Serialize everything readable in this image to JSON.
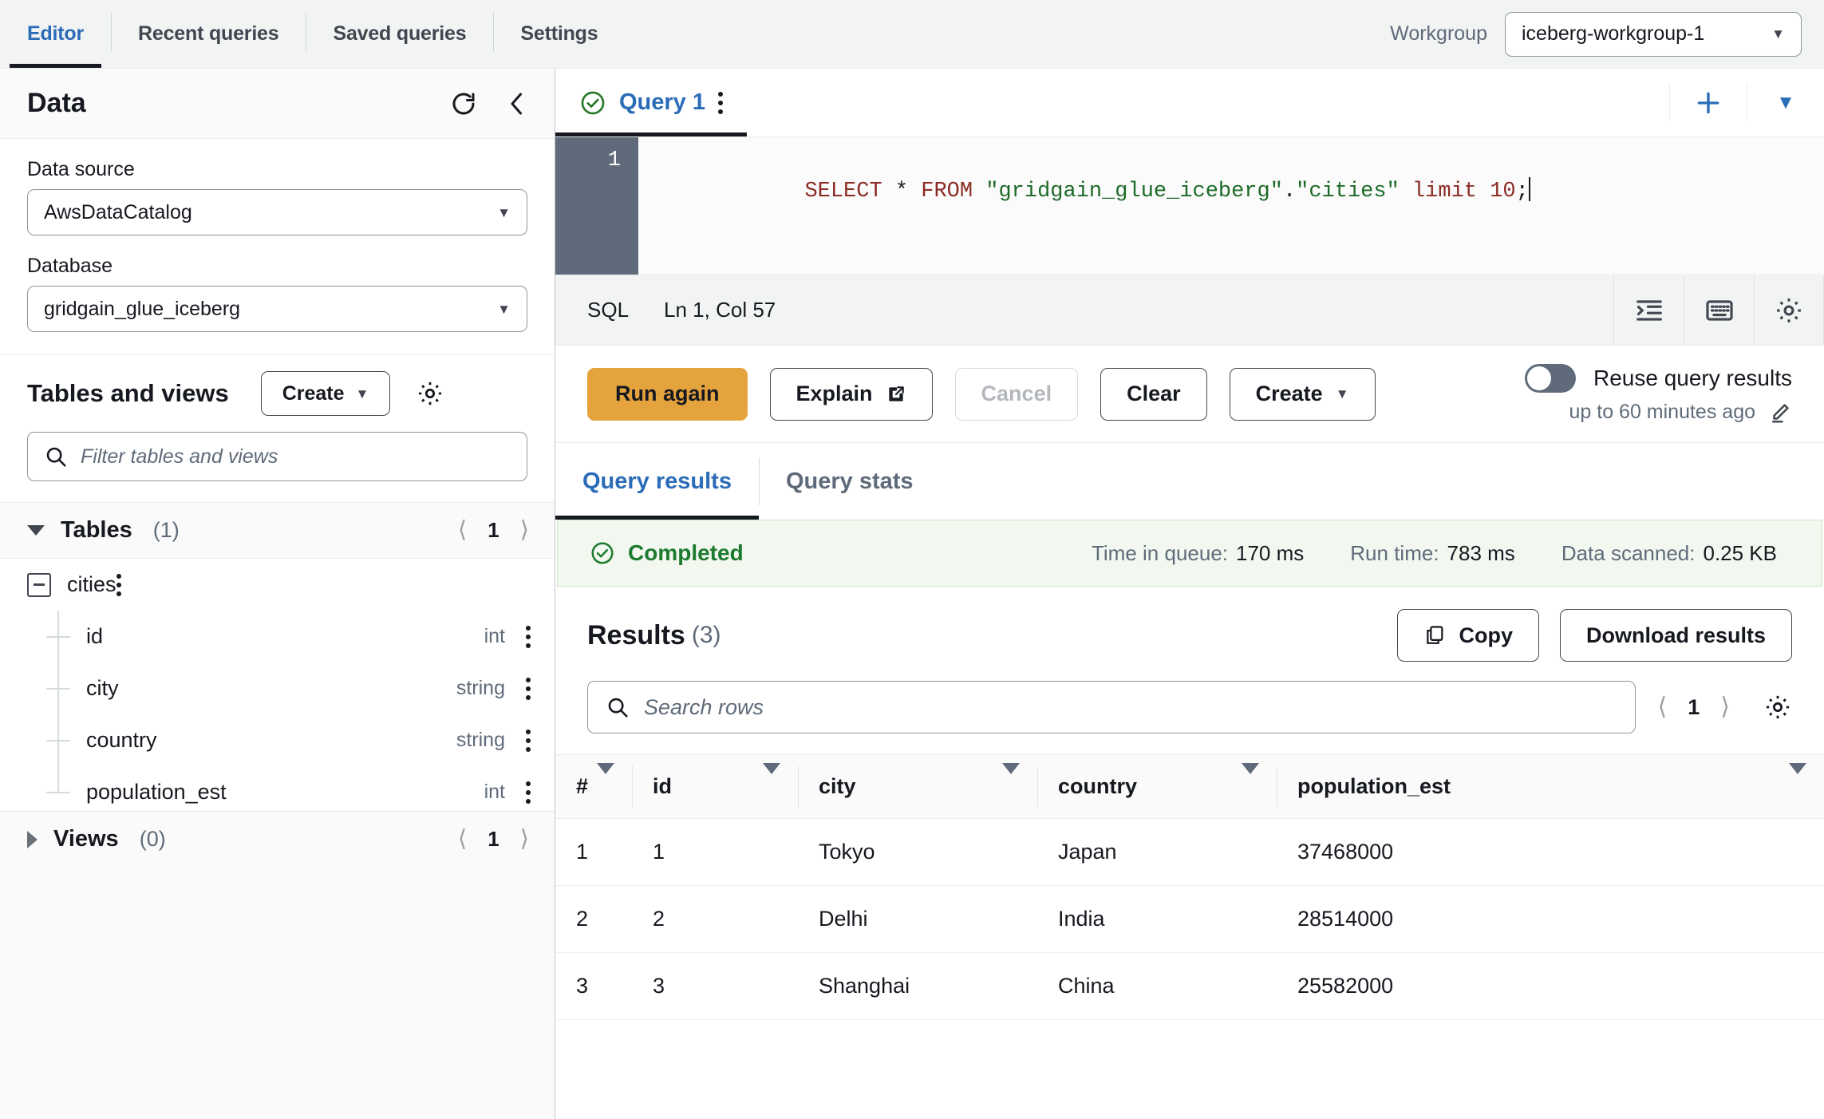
{
  "topnav": {
    "tabs": [
      {
        "label": "Editor",
        "active": true
      },
      {
        "label": "Recent queries",
        "active": false
      },
      {
        "label": "Saved queries",
        "active": false
      },
      {
        "label": "Settings",
        "active": false
      }
    ],
    "workgroup_label": "Workgroup",
    "workgroup_value": "iceberg-workgroup-1"
  },
  "sidebar": {
    "title": "Data",
    "data_source_label": "Data source",
    "data_source_value": "AwsDataCatalog",
    "database_label": "Database",
    "database_value": "gridgain_glue_iceberg",
    "tables_views_title": "Tables and views",
    "create_label": "Create",
    "filter_placeholder": "Filter tables and views",
    "tables_group": {
      "name": "Tables",
      "count": "(1)",
      "page": "1"
    },
    "views_group": {
      "name": "Views",
      "count": "(0)",
      "page": "1"
    },
    "table_name": "cities",
    "columns": [
      {
        "name": "id",
        "type": "int"
      },
      {
        "name": "city",
        "type": "string"
      },
      {
        "name": "country",
        "type": "string"
      },
      {
        "name": "population_est",
        "type": "int"
      }
    ]
  },
  "editor": {
    "tab_label": "Query 1",
    "line_number": "1",
    "sql_tokens": [
      {
        "t": "SELECT",
        "c": "kw"
      },
      {
        "t": " ",
        "c": "plain"
      },
      {
        "t": "*",
        "c": "punct"
      },
      {
        "t": " ",
        "c": "plain"
      },
      {
        "t": "FROM",
        "c": "kw"
      },
      {
        "t": " ",
        "c": "plain"
      },
      {
        "t": "\"gridgain_glue_iceberg\"",
        "c": "str"
      },
      {
        "t": ".",
        "c": "punct"
      },
      {
        "t": "\"cities\"",
        "c": "str"
      },
      {
        "t": " ",
        "c": "plain"
      },
      {
        "t": "limit",
        "c": "kw"
      },
      {
        "t": " ",
        "c": "plain"
      },
      {
        "t": "10",
        "c": "kw"
      },
      {
        "t": ";",
        "c": "punct"
      }
    ],
    "sql_text": "SELECT * FROM \"gridgain_glue_iceberg\".\"cities\" limit 10;",
    "language": "SQL",
    "cursor_position": "Ln 1, Col 57"
  },
  "actions": {
    "run_again": "Run again",
    "explain": "Explain",
    "cancel": "Cancel",
    "clear": "Clear",
    "create": "Create",
    "reuse_label": "Reuse query results",
    "reuse_sub": "up to 60 minutes ago",
    "reuse_enabled": false
  },
  "result_tabs": [
    {
      "label": "Query results",
      "active": true
    },
    {
      "label": "Query stats",
      "active": false
    }
  ],
  "status": {
    "state": "Completed",
    "time_in_queue_label": "Time in queue:",
    "time_in_queue_value": "170 ms",
    "run_time_label": "Run time:",
    "run_time_value": "783 ms",
    "data_scanned_label": "Data scanned:",
    "data_scanned_value": "0.25 KB"
  },
  "results": {
    "title": "Results",
    "count": "(3)",
    "copy_label": "Copy",
    "download_label": "Download results",
    "search_placeholder": "Search rows",
    "page": "1",
    "columns": [
      "#",
      "id",
      "city",
      "country",
      "population_est"
    ],
    "rows": [
      {
        "num": "1",
        "id": "1",
        "city": "Tokyo",
        "country": "Japan",
        "population_est": "37468000"
      },
      {
        "num": "2",
        "id": "2",
        "city": "Delhi",
        "country": "India",
        "population_est": "28514000"
      },
      {
        "num": "3",
        "id": "3",
        "city": "Shanghai",
        "country": "China",
        "population_est": "25582000"
      }
    ]
  },
  "colors": {
    "accent_blue": "#2b6cb8",
    "primary_orange": "#e5a33d",
    "success_green": "#1d7b2f",
    "sql_keyword": "#8b2c24",
    "sql_string": "#1d6b28"
  }
}
